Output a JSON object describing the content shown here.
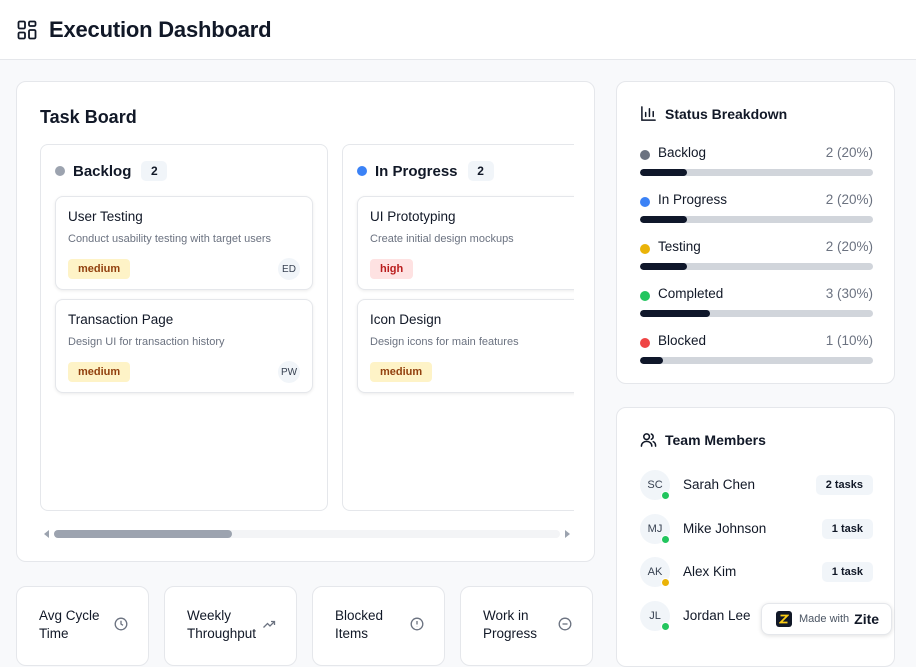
{
  "header": {
    "title": "Execution Dashboard",
    "icon": "layout-grid-icon"
  },
  "task_board": {
    "title": "Task Board",
    "columns": [
      {
        "name": "Backlog",
        "count": "2",
        "color": "#6b7280",
        "tasks": [
          {
            "title": "User Testing",
            "description": "Conduct usability testing with target users",
            "priority": "medium",
            "assignee": "ED"
          },
          {
            "title": "Transaction Page",
            "description": "Design UI for transaction history",
            "priority": "medium",
            "assignee": "PW"
          }
        ]
      },
      {
        "name": "In Progress",
        "count": "2",
        "color": "#3b82f6",
        "tasks": [
          {
            "title": "UI Prototyping",
            "description": "Create initial design mockups",
            "priority": "high",
            "assignee": ""
          },
          {
            "title": "Icon Design",
            "description": "Design icons for main features",
            "priority": "medium",
            "assignee": ""
          }
        ]
      }
    ],
    "scroll_position": 0.33
  },
  "status_breakdown": {
    "title": "Status Breakdown",
    "icon": "bar-chart-icon",
    "items": [
      {
        "label": "Backlog",
        "value": "2 (20%)",
        "percent": 20,
        "color": "#6b7280"
      },
      {
        "label": "In Progress",
        "value": "2 (20%)",
        "percent": 20,
        "color": "#3b82f6"
      },
      {
        "label": "Testing",
        "value": "2 (20%)",
        "percent": 20,
        "color": "#eab308"
      },
      {
        "label": "Completed",
        "value": "3 (30%)",
        "percent": 30,
        "color": "#22c55e"
      },
      {
        "label": "Blocked",
        "value": "1 (10%)",
        "percent": 10,
        "color": "#ef4444"
      }
    ]
  },
  "team_members": {
    "title": "Team Members",
    "icon": "users-icon",
    "members": [
      {
        "initials": "SC",
        "name": "Sarah Chen",
        "tasks": "2 tasks",
        "status_color": "#22c55e"
      },
      {
        "initials": "MJ",
        "name": "Mike Johnson",
        "tasks": "1 task",
        "status_color": "#22c55e"
      },
      {
        "initials": "AK",
        "name": "Alex Kim",
        "tasks": "1 task",
        "status_color": "#eab308"
      },
      {
        "initials": "JL",
        "name": "Jordan Lee",
        "tasks": "",
        "status_color": "#22c55e"
      }
    ]
  },
  "metrics": [
    {
      "label": "Avg Cycle Time",
      "icon": "clock-icon"
    },
    {
      "label": "Weekly Throughput",
      "icon": "trending-up-icon"
    },
    {
      "label": "Blocked Items",
      "icon": "alert-circle-icon"
    },
    {
      "label": "Work in Progress",
      "icon": "minus-circle-icon"
    }
  ],
  "zite_badge": {
    "made_with": "Made with",
    "brand": "Zite"
  }
}
